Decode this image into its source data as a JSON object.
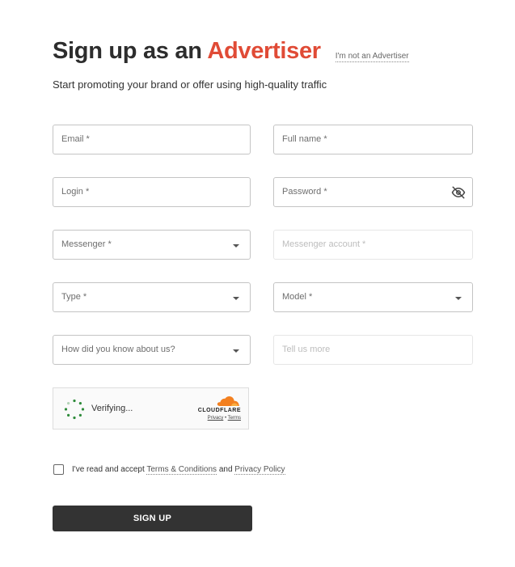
{
  "header": {
    "title_prefix": "Sign up as an ",
    "title_accent": "Advertiser",
    "not_advertiser_link": "I'm not an Advertiser",
    "subtitle": "Start promoting your brand or offer using high-quality traffic",
    "accent_color": "#e04b36"
  },
  "form": {
    "email": "Email *",
    "full_name": "Full name *",
    "login": "Login *",
    "password": "Password *",
    "messenger": "Messenger *",
    "messenger_account": "Messenger account *",
    "type": "Type *",
    "model": "Model *",
    "how_know": "How did you know about us?",
    "tell_more": "Tell us more"
  },
  "captcha": {
    "status": "Verifying...",
    "brand": "CLOUDFLARE",
    "privacy": "Privacy",
    "separator": "•",
    "terms": "Terms"
  },
  "agreement": {
    "prefix": "I've read and accept ",
    "terms_link": "Terms & Conditions",
    "conjunction": " and ",
    "privacy_link": "Privacy Policy"
  },
  "submit_label": "SIGN UP"
}
